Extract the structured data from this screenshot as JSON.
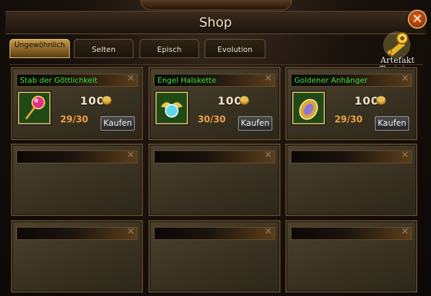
{
  "window": {
    "title": "Shop"
  },
  "tabs": [
    {
      "label": "Ungewöhnlich",
      "active": true
    },
    {
      "label": "Selten",
      "active": false
    },
    {
      "label": "Episch",
      "active": false
    },
    {
      "label": "Evolution",
      "active": false
    }
  ],
  "artifact_training": {
    "line1": "Artefakt",
    "line2": "Training",
    "icon": "golden-key-icon"
  },
  "items": [
    {
      "name": "Stab der Göttlichkeit",
      "price": "100",
      "stock": "29/30",
      "buy_label": "Kaufen",
      "icon": "staff-icon",
      "currency_icon": "gold-coin-icon"
    },
    {
      "name": "Engel Halskette",
      "price": "100",
      "stock": "30/30",
      "buy_label": "Kaufen",
      "icon": "winged-necklace-icon",
      "currency_icon": "gold-coin-icon"
    },
    {
      "name": "Goldener Anhänger",
      "price": "100",
      "stock": "29/30",
      "buy_label": "Kaufen",
      "icon": "golden-pendant-icon",
      "currency_icon": "gold-coin-icon"
    }
  ],
  "colors": {
    "item_name": "#38e33a",
    "stock": "#eca140",
    "tab_active": "#c69a48"
  }
}
